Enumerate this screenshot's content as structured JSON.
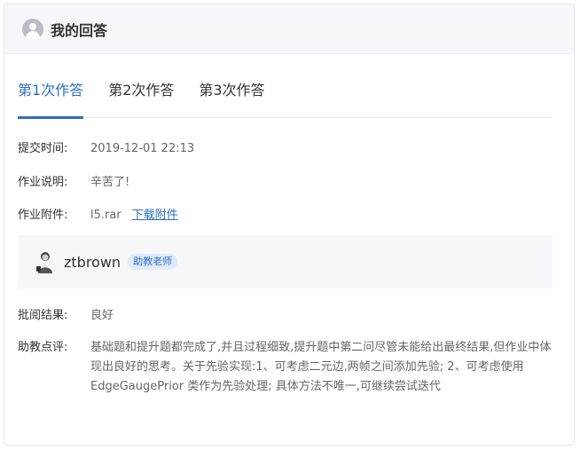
{
  "header": {
    "title": "我的回答"
  },
  "tabs": [
    {
      "label": "第1次作答",
      "active": true
    },
    {
      "label": "第2次作答",
      "active": false
    },
    {
      "label": "第3次作答",
      "active": false
    }
  ],
  "submission": {
    "time_label": "提交时间:",
    "time_value": "2019-12-01 22:13",
    "note_label": "作业说明:",
    "note_value": "辛苦了!",
    "attachment_label": "作业附件:",
    "attachment_file": "l5.rar",
    "attachment_download": "下载附件"
  },
  "reviewer": {
    "name": "ztbrown",
    "badge": "助教老师"
  },
  "review": {
    "result_label": "批阅结果:",
    "result_value": "良好",
    "comment_label": "助教点评:",
    "comment_value": "基础题和提升题都完成了,并且过程细致,提升题中第二问尽管未能给出最终结果,但作业中体现出良好的思考。关于先验实现:1、可考虑二元边,两帧之间添加先验; 2、可考虑使用EdgeGaugePrior 类作为先验处理; 具体方法不唯一,可继续尝试迭代"
  },
  "colors": {
    "accent": "#2d6fc0",
    "header_bg": "#f5f7fa",
    "badge_bg": "#dfeafb"
  }
}
